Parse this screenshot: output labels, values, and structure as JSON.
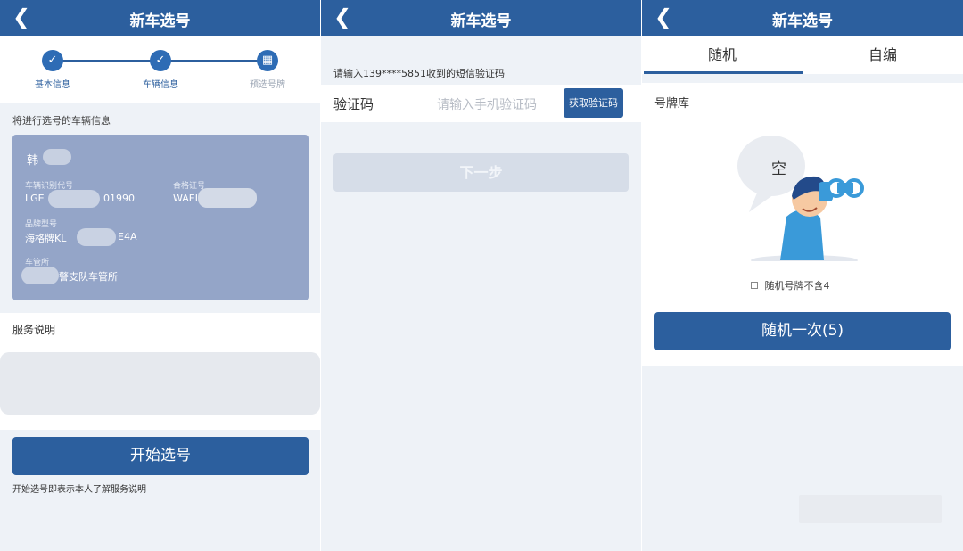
{
  "panel1": {
    "nav": {
      "back_icon": "chevron-left",
      "title": "新车选号"
    },
    "steps": [
      {
        "label": "基本信息",
        "state": "done"
      },
      {
        "label": "车辆信息",
        "state": "done"
      },
      {
        "label": "预选号牌",
        "state": "current"
      }
    ],
    "section_label": "将进行选号的车辆信息",
    "vehicle": {
      "owner": "韩",
      "vin_label": "车辆识别代号",
      "vin_start": "LGE",
      "vin_end": "01990",
      "cert_label": "合格证号",
      "cert_value": "WAEL",
      "brand_label": "品牌型号",
      "brand_start": "海格牌KL",
      "brand_end": "E4A",
      "office_label": "车管所",
      "office_value": "警支队车管所"
    },
    "service_title": "服务说明",
    "start_button": "开始选号",
    "footnote": "开始选号即表示本人了解服务说明"
  },
  "panel2": {
    "nav": {
      "back_icon": "chevron-left",
      "title": "新车选号"
    },
    "sms_hint": "请输入139****5851收到的短信验证码",
    "code_label": "验证码",
    "code_placeholder": "请输入手机验证码",
    "get_code_button": "获取验证码",
    "next_button": "下一步"
  },
  "panel3": {
    "nav": {
      "back_icon": "chevron-left",
      "title": "新车选号"
    },
    "tabs": [
      {
        "label": "随机",
        "active": true
      },
      {
        "label": "自编",
        "active": false
      }
    ],
    "library_label": "号牌库",
    "empty_bubble": "空",
    "exclude_four": "随机号牌不含4",
    "random_button": "随机一次(5)"
  },
  "colors": {
    "primary": "#2c5f9e",
    "card": "#94a5c8",
    "background": "#eef2f7",
    "disabled_button": "#d6dde8"
  }
}
